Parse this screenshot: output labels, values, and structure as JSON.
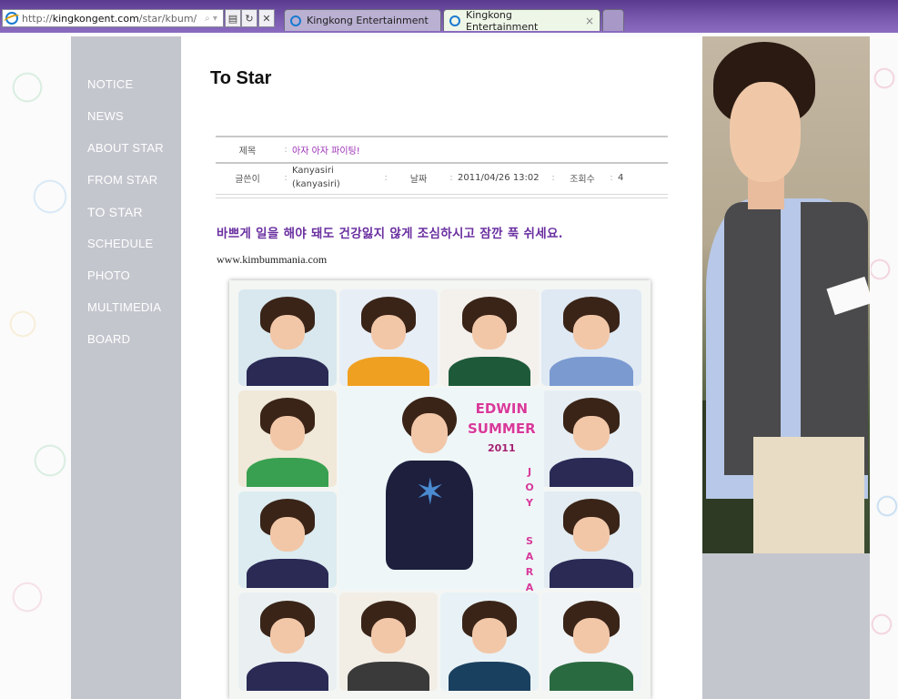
{
  "browser": {
    "address_prefix": "http://",
    "address_domain": "kingkongent.com",
    "address_path": "/star/kbum/",
    "go_label": "⌕ ▾",
    "tabs": [
      {
        "label": "Kingkong Entertainment",
        "active": false
      },
      {
        "label": "Kingkong Entertainment",
        "active": true
      }
    ],
    "tab_close": "×"
  },
  "nav": {
    "items": [
      {
        "label": "NOTICE"
      },
      {
        "label": "NEWS"
      },
      {
        "label": "ABOUT STAR"
      },
      {
        "label": "FROM STAR"
      },
      {
        "label": "TO STAR",
        "active": true
      },
      {
        "label": "SCHEDULE"
      },
      {
        "label": "PHOTO"
      },
      {
        "label": "MULTIMEDIA"
      },
      {
        "label": "BOARD"
      }
    ]
  },
  "main": {
    "title": "To Star",
    "post": {
      "subject_label": "제목",
      "subject": "아자 아자 파이팅!",
      "author_label": "글쓴이",
      "author": "Kanyasiri",
      "author_id": "(kanyasiri)",
      "date_label": "날짜",
      "date": "2011/04/26 13:02",
      "views_label": "조회수",
      "views": "4",
      "separator": ":",
      "body_heading": "바쁘게 일을 해야 돼도 건강잃지 않게 조심하시고 잠깐 푹 쉬세요.",
      "body_url": "www.kimbummania.com"
    },
    "collage": {
      "line1": "EDWIN",
      "line2": "SUMMER",
      "year": "2011",
      "vertical1": "JOY",
      "vertical2": "SARA",
      "shirt_colors": [
        "#2a2a55",
        "#f0a020",
        "#1e5a3a",
        "#7a9ad0",
        "#38a050",
        "#2a2a55",
        "#3a3a3a",
        "#1a4060",
        "#2a2a55",
        "#2a6a40"
      ]
    }
  }
}
